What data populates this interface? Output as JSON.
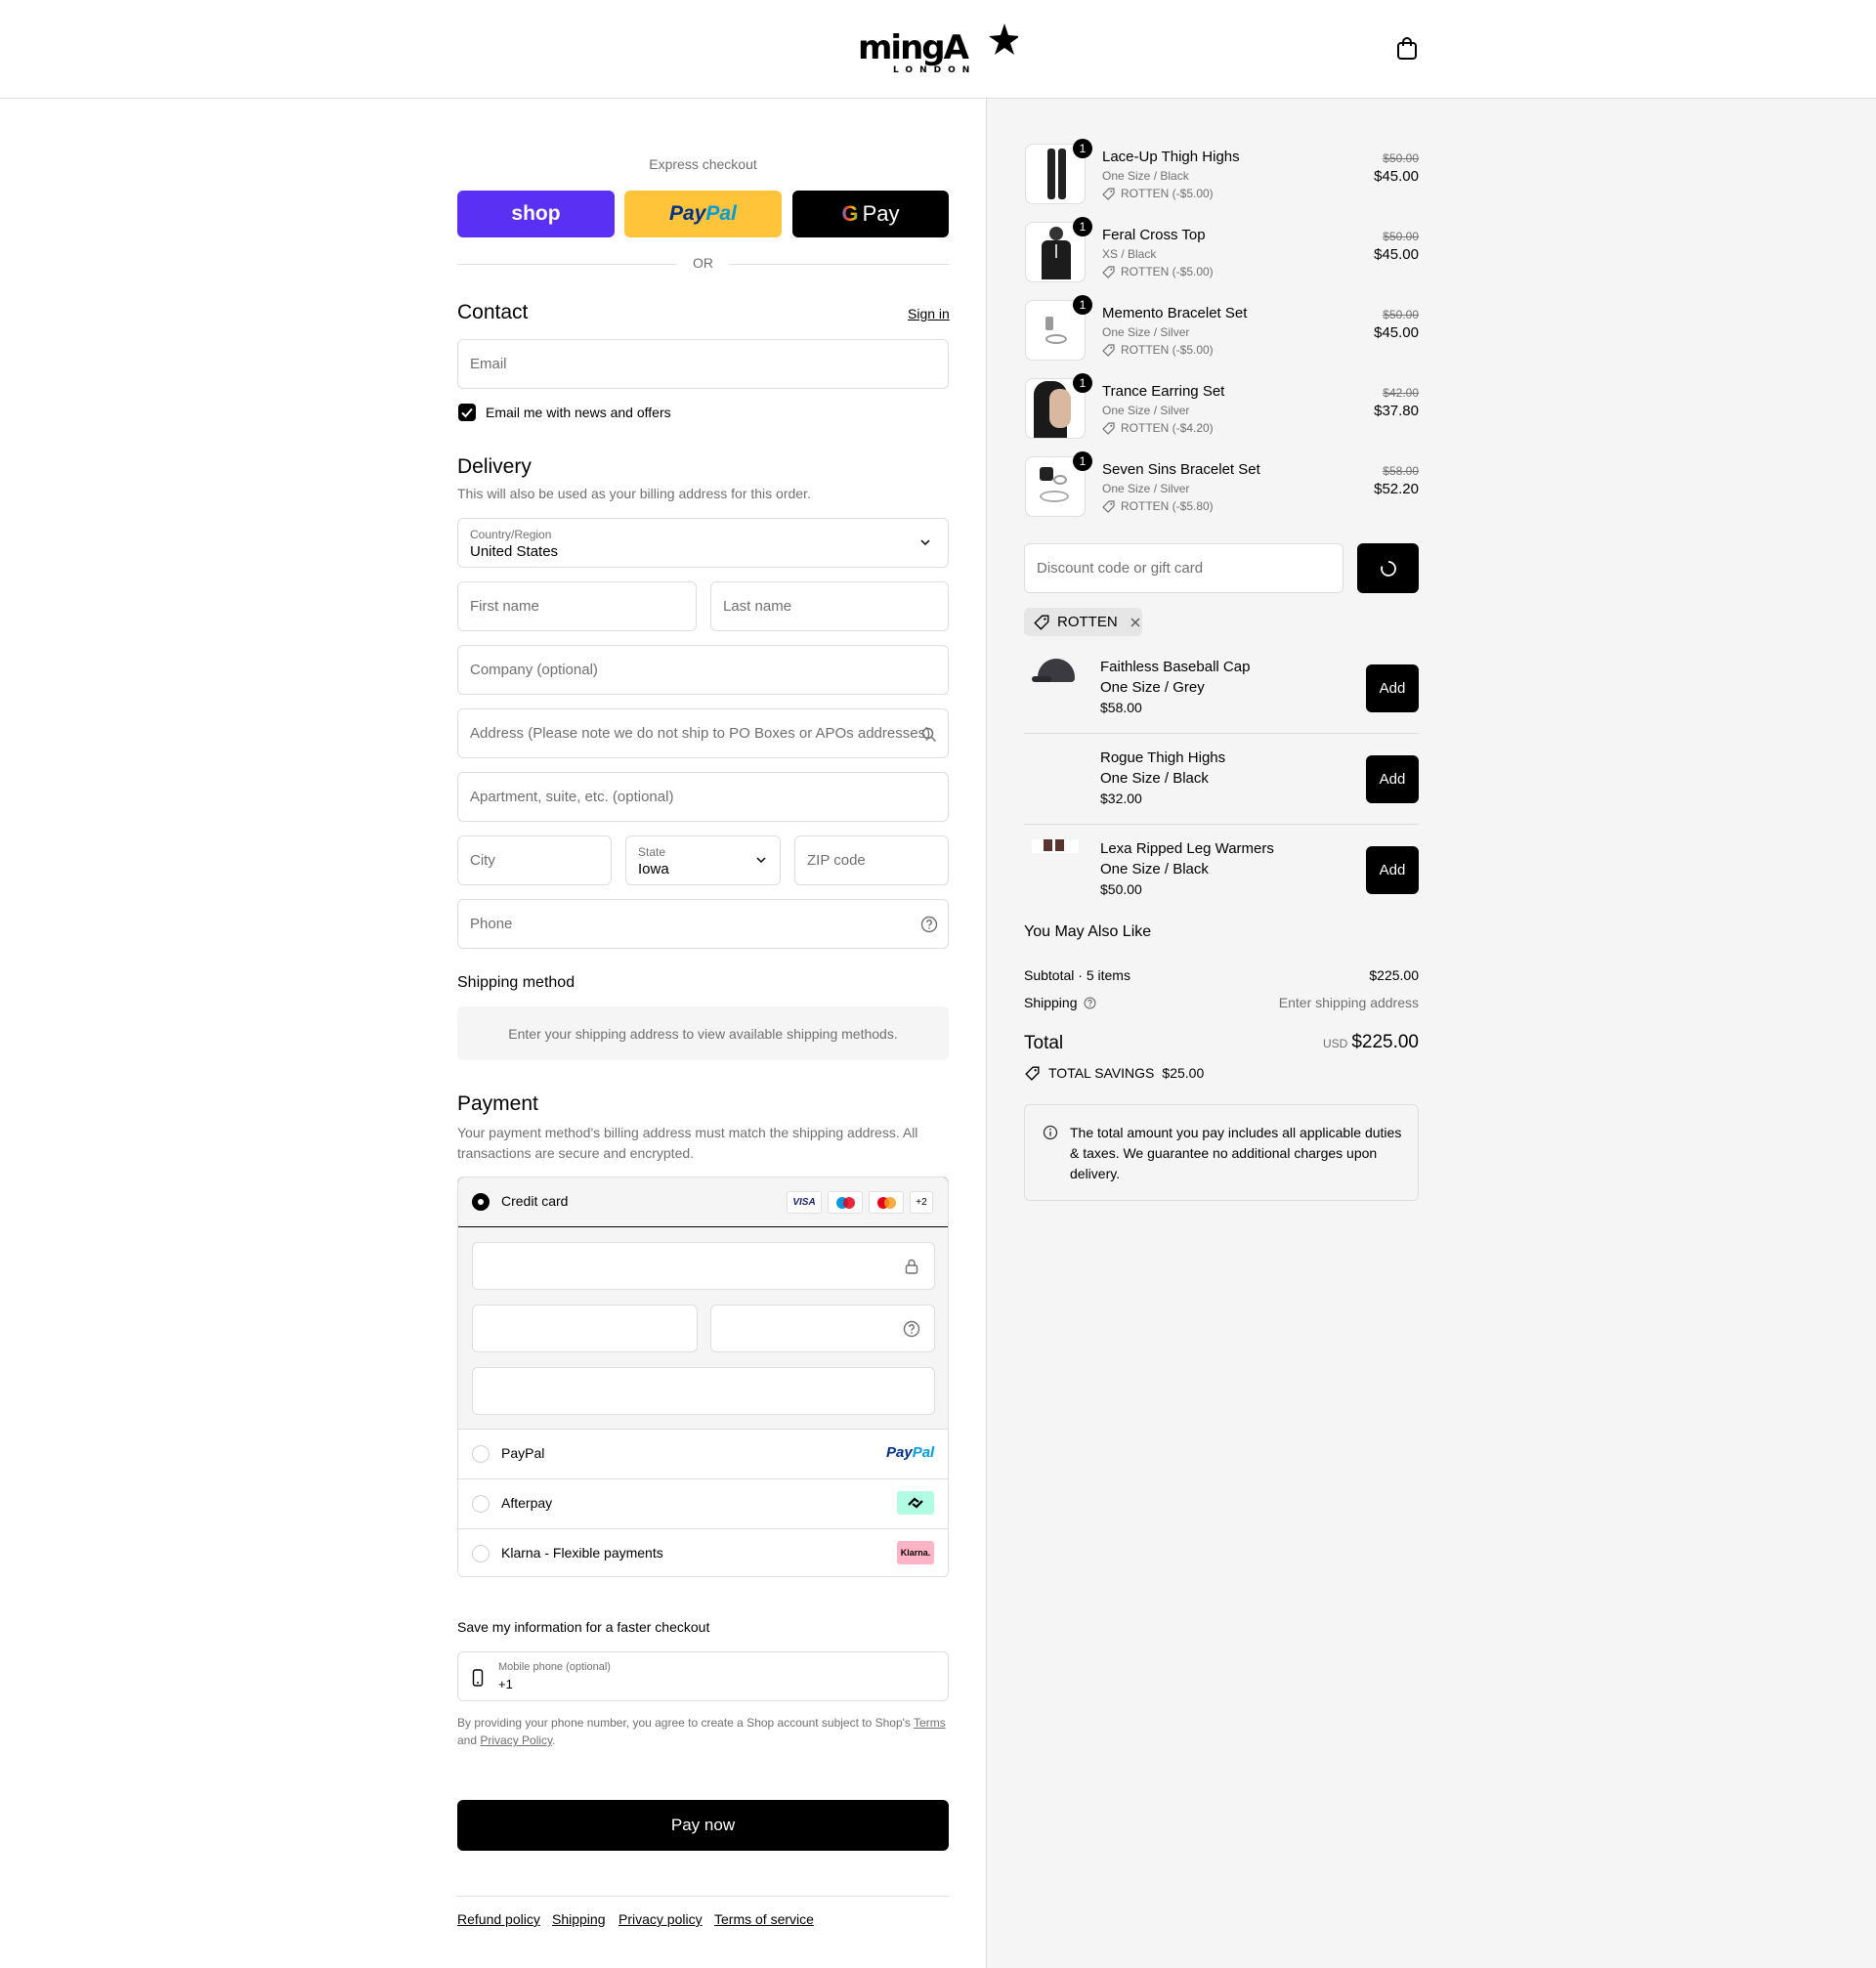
{
  "brand": {
    "name": "mingA",
    "sub": "LONDON"
  },
  "express": {
    "label": "Express checkout",
    "shop": "shop",
    "paypal_a": "Pay",
    "paypal_b": "Pal",
    "gpay": "Pay",
    "or": "OR"
  },
  "contact": {
    "title": "Contact",
    "sign_in": "Sign in",
    "email_placeholder": "Email",
    "news_label": "Email me with news and offers"
  },
  "delivery": {
    "title": "Delivery",
    "subtitle": "This will also be used as your billing address for this order.",
    "country_label": "Country/Region",
    "country_value": "United States",
    "first_name": "First name",
    "last_name": "Last name",
    "company": "Company (optional)",
    "address": "Address (Please note we do not ship to PO Boxes or APOs addresses)",
    "apartment": "Apartment, suite, etc. (optional)",
    "city": "City",
    "state_label": "State",
    "state_value": "Iowa",
    "zip": "ZIP code",
    "phone": "Phone"
  },
  "shipping_method": {
    "title": "Shipping method",
    "notice": "Enter your shipping address to view available shipping methods."
  },
  "payment": {
    "title": "Payment",
    "subtitle": "Your payment method's billing address must match the shipping address. All transactions are secure and encrypted.",
    "credit_card": "Credit card",
    "visa": "VISA",
    "more_cards": "+2",
    "paypal": "PayPal",
    "paypal_logo_a": "Pay",
    "paypal_logo_b": "Pal",
    "afterpay": "Afterpay",
    "klarna": "Klarna - Flexible payments",
    "klarna_badge": "Klarna."
  },
  "save_info": {
    "title": "Save my information for a faster checkout",
    "mobile_label": "Mobile phone (optional)",
    "mobile_value": "+1",
    "legal_a": "By providing your phone number, you agree to create a Shop account subject to Shop's",
    "terms": "Terms",
    "legal_b": "and",
    "privacy": "Privacy Policy",
    "legal_c": "."
  },
  "pay_now": "Pay now",
  "footer": {
    "refund": "Refund policy",
    "shipping": "Shipping",
    "privacy": "Privacy policy",
    "terms": "Terms of service"
  },
  "cart_items": [
    {
      "name": "Lace-Up Thigh Highs",
      "variant": "One Size / Black",
      "discount": "ROTTEN (-$5.00)",
      "old_price": "$50.00",
      "price": "$45.00",
      "qty": "1"
    },
    {
      "name": "Feral Cross Top",
      "variant": "XS / Black",
      "discount": "ROTTEN (-$5.00)",
      "old_price": "$50.00",
      "price": "$45.00",
      "qty": "1"
    },
    {
      "name": "Memento Bracelet Set",
      "variant": "One Size / Silver",
      "discount": "ROTTEN (-$5.00)",
      "old_price": "$50.00",
      "price": "$45.00",
      "qty": "1"
    },
    {
      "name": "Trance Earring Set",
      "variant": "One Size / Silver",
      "discount": "ROTTEN (-$4.20)",
      "old_price": "$42.00",
      "price": "$37.80",
      "qty": "1"
    },
    {
      "name": "Seven Sins Bracelet Set",
      "variant": "One Size / Silver",
      "discount": "ROTTEN (-$5.80)",
      "old_price": "$58.00",
      "price": "$52.20",
      "qty": "1"
    }
  ],
  "discount": {
    "placeholder": "Discount code or gift card",
    "applied_code": "ROTTEN"
  },
  "upsell": [
    {
      "name": "Faithless Baseball Cap",
      "variant": "One Size / Grey",
      "price": "$58.00",
      "add": "Add"
    },
    {
      "name": "Rogue Thigh Highs",
      "variant": "One Size / Black",
      "price": "$32.00",
      "add": "Add"
    },
    {
      "name": "Lexa Ripped Leg Warmers",
      "variant": "One Size / Black",
      "price": "$50.00",
      "add": "Add"
    }
  ],
  "you_may_like": "You May Also Like",
  "summary": {
    "subtotal_label": "Subtotal · 5 items",
    "subtotal_value": "$225.00",
    "shipping_label": "Shipping",
    "shipping_value": "Enter shipping address",
    "total_label": "Total",
    "currency": "USD",
    "total_value": "$225.00",
    "savings_label": "TOTAL SAVINGS",
    "savings_value": "$25.00",
    "duties_note": "The total amount you pay includes all applicable duties & taxes. We guarantee no additional charges upon delivery."
  }
}
